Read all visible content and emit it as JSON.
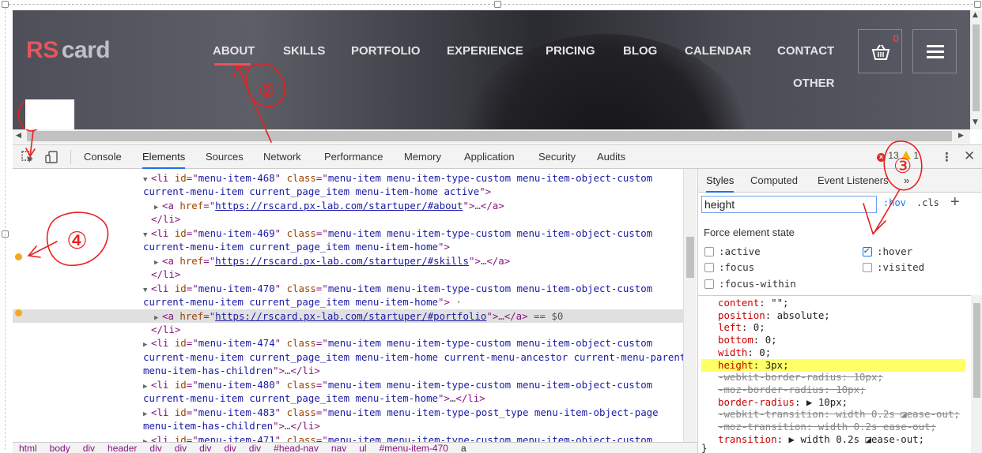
{
  "site": {
    "brand_rs": "RS",
    "brand_card": "card",
    "nav": [
      "ABOUT",
      "SKILLS",
      "PORTFOLIO",
      "EXPERIENCE",
      "PRICING",
      "BLOG",
      "CALENDAR",
      "CONTACT",
      "OTHER"
    ],
    "cart_count": "0",
    "colors": {
      "accent": "#e8545e",
      "nav_text": "#e3e4e8"
    }
  },
  "devtools": {
    "tabs": [
      "Console",
      "Elements",
      "Sources",
      "Network",
      "Performance",
      "Memory",
      "Application",
      "Security",
      "Audits"
    ],
    "active_tab": "Elements",
    "error_count": "13",
    "warning_count": "1",
    "icons": [
      "inspect-element-icon",
      "device-toolbar-icon",
      "error-icon",
      "warning-icon",
      "more-options-icon",
      "close-icon"
    ]
  },
  "elements": {
    "lines": [
      {
        "indent": 1,
        "tw": "▼",
        "parts": [
          [
            "tag",
            "<li "
          ],
          [
            "an",
            "id"
          ],
          [
            "tag",
            "=\""
          ],
          [
            "av",
            "menu-item-468"
          ],
          [
            "tag",
            "\" "
          ],
          [
            "an",
            "class"
          ],
          [
            "tag",
            "=\""
          ],
          [
            "av",
            "menu-item menu-item-type-custom menu-item-object-custom"
          ]
        ]
      },
      {
        "indent": 0,
        "tw": "",
        "parts": [
          [
            "av",
            "current-menu-item current_page_item menu-item-home active"
          ],
          [
            "tag",
            "\">"
          ]
        ]
      },
      {
        "indent": 2,
        "tw": "▶",
        "parts": [
          [
            "tag",
            "<a "
          ],
          [
            "an",
            "href"
          ],
          [
            "tag",
            "=\""
          ],
          [
            "lnk",
            "https://rscard.px-lab.com/startuper/#about"
          ],
          [
            "tag",
            "\">"
          ],
          [
            "dim",
            "…"
          ],
          [
            "tag",
            "</a>"
          ]
        ]
      },
      {
        "indent": 1,
        "tw": " ",
        "parts": [
          [
            "tag",
            "</li>"
          ]
        ]
      },
      {
        "indent": 1,
        "tw": "▼",
        "parts": [
          [
            "tag",
            "<li "
          ],
          [
            "an",
            "id"
          ],
          [
            "tag",
            "=\""
          ],
          [
            "av",
            "menu-item-469"
          ],
          [
            "tag",
            "\" "
          ],
          [
            "an",
            "class"
          ],
          [
            "tag",
            "=\""
          ],
          [
            "av",
            "menu-item menu-item-type-custom menu-item-object-custom"
          ]
        ]
      },
      {
        "indent": 0,
        "tw": "",
        "parts": [
          [
            "av",
            "current-menu-item current_page_item menu-item-home"
          ],
          [
            "tag",
            "\">"
          ]
        ]
      },
      {
        "indent": 2,
        "tw": "▶",
        "parts": [
          [
            "tag",
            "<a "
          ],
          [
            "an",
            "href"
          ],
          [
            "tag",
            "=\""
          ],
          [
            "lnk",
            "https://rscard.px-lab.com/startuper/#skills"
          ],
          [
            "tag",
            "\">"
          ],
          [
            "dim",
            "…"
          ],
          [
            "tag",
            "</a>"
          ]
        ]
      },
      {
        "indent": 1,
        "tw": " ",
        "parts": [
          [
            "tag",
            "</li>"
          ]
        ]
      },
      {
        "indent": 1,
        "tw": "▼",
        "parts": [
          [
            "tag",
            "<li "
          ],
          [
            "an",
            "id"
          ],
          [
            "tag",
            "=\""
          ],
          [
            "av",
            "menu-item-470"
          ],
          [
            "tag",
            "\" "
          ],
          [
            "an",
            "class"
          ],
          [
            "tag",
            "=\""
          ],
          [
            "av",
            "menu-item menu-item-type-custom menu-item-object-custom"
          ]
        ]
      },
      {
        "indent": 0,
        "tw": "",
        "parts": [
          [
            "av",
            "current-menu-item current_page_item menu-item-home"
          ],
          [
            "tag",
            "\">"
          ],
          [
            "dim",
            " ·"
          ]
        ]
      },
      {
        "indent": 2,
        "tw": "▶",
        "hl": true,
        "parts": [
          [
            "tag",
            "<a "
          ],
          [
            "an",
            "href"
          ],
          [
            "tag",
            "=\""
          ],
          [
            "lnk",
            "https://rscard.px-lab.com/startuper/#portfolio"
          ],
          [
            "tag",
            "\">"
          ],
          [
            "dim",
            "…"
          ],
          [
            "tag",
            "</a>"
          ],
          [
            "dim",
            " == $0"
          ]
        ]
      },
      {
        "indent": 1,
        "tw": " ",
        "parts": [
          [
            "tag",
            "</li>"
          ]
        ]
      },
      {
        "indent": 1,
        "tw": "▶",
        "parts": [
          [
            "tag",
            "<li "
          ],
          [
            "an",
            "id"
          ],
          [
            "tag",
            "=\""
          ],
          [
            "av",
            "menu-item-474"
          ],
          [
            "tag",
            "\" "
          ],
          [
            "an",
            "class"
          ],
          [
            "tag",
            "=\""
          ],
          [
            "av",
            "menu-item menu-item-type-custom menu-item-object-custom"
          ]
        ]
      },
      {
        "indent": 0,
        "tw": "",
        "parts": [
          [
            "av",
            "current-menu-item current_page_item menu-item-home current-menu-ancestor current-menu-parent"
          ]
        ]
      },
      {
        "indent": 0,
        "tw": "",
        "parts": [
          [
            "av",
            "menu-item-has-children"
          ],
          [
            "tag",
            "\">"
          ],
          [
            "dim",
            "…"
          ],
          [
            "tag",
            "</li>"
          ]
        ]
      },
      {
        "indent": 1,
        "tw": "▶",
        "parts": [
          [
            "tag",
            "<li "
          ],
          [
            "an",
            "id"
          ],
          [
            "tag",
            "=\""
          ],
          [
            "av",
            "menu-item-480"
          ],
          [
            "tag",
            "\" "
          ],
          [
            "an",
            "class"
          ],
          [
            "tag",
            "=\""
          ],
          [
            "av",
            "menu-item menu-item-type-custom menu-item-object-custom"
          ]
        ]
      },
      {
        "indent": 0,
        "tw": "",
        "parts": [
          [
            "av",
            "current-menu-item current_page_item menu-item-home"
          ],
          [
            "tag",
            "\">"
          ],
          [
            "dim",
            "…"
          ],
          [
            "tag",
            "</li>"
          ]
        ]
      },
      {
        "indent": 1,
        "tw": "▶",
        "parts": [
          [
            "tag",
            "<li "
          ],
          [
            "an",
            "id"
          ],
          [
            "tag",
            "=\""
          ],
          [
            "av",
            "menu-item-483"
          ],
          [
            "tag",
            "\" "
          ],
          [
            "an",
            "class"
          ],
          [
            "tag",
            "=\""
          ],
          [
            "av",
            "menu-item menu-item-type-post_type menu-item-object-page"
          ]
        ]
      },
      {
        "indent": 0,
        "tw": "",
        "parts": [
          [
            "av",
            "menu-item-has-children"
          ],
          [
            "tag",
            "\">"
          ],
          [
            "dim",
            "…"
          ],
          [
            "tag",
            "</li>"
          ]
        ]
      },
      {
        "indent": 1,
        "tw": "▶",
        "parts": [
          [
            "tag",
            "<li "
          ],
          [
            "an",
            "id"
          ],
          [
            "tag",
            "=\""
          ],
          [
            "av",
            "menu-item-471"
          ],
          [
            "tag",
            "\" "
          ],
          [
            "an",
            "class"
          ],
          [
            "tag",
            "=\""
          ],
          [
            "av",
            "menu-item menu-item-type-custom menu-item-object-custom"
          ]
        ]
      }
    ],
    "breadcrumbs": [
      "html",
      "body",
      "div",
      "header",
      "div",
      "div",
      "div",
      "div",
      "div",
      "#head-nav",
      "nav",
      "ul",
      "#menu-item-470",
      "a"
    ]
  },
  "styles": {
    "tabs": [
      "Styles",
      "Computed",
      "Event Listeners",
      "»"
    ],
    "filter_value": "height",
    "hov_label": ":hov",
    "cls_label": ".cls",
    "add_label": "+",
    "force_title": "Force element state",
    "states": [
      {
        "label": ":active",
        "checked": false
      },
      {
        "label": ":hover",
        "checked": true
      },
      {
        "label": ":focus",
        "checked": false
      },
      {
        "label": ":visited",
        "checked": false
      },
      {
        "label": ":focus-within",
        "checked": false
      }
    ],
    "rules": [
      {
        "name": "content",
        "value": "\"\";",
        "strike": false
      },
      {
        "name": "position",
        "value": "absolute;",
        "strike": false
      },
      {
        "name": "left",
        "value": "0;",
        "strike": false
      },
      {
        "name": "bottom",
        "value": "0;",
        "strike": false
      },
      {
        "name": "width",
        "value": "0;",
        "strike": false
      },
      {
        "name": "height",
        "value": "3px;",
        "strike": false,
        "highlight": true
      },
      {
        "name": "-webkit-border-radius",
        "value": "10px;",
        "strike": true
      },
      {
        "name": "-moz-border-radius",
        "value": "10px;",
        "strike": true
      },
      {
        "name": "border-radius",
        "value": "▶ 10px;",
        "strike": false
      },
      {
        "name": "-webkit-transition",
        "value": "width 0.2s ◪ease-out;",
        "strike": true
      },
      {
        "name": "-moz-transition",
        "value": "width 0.2s ease-out;",
        "strike": true
      },
      {
        "name": "transition",
        "value": "▶ width 0.2s ◪ease-out;",
        "strike": false
      }
    ],
    "close_brace": "}"
  },
  "annotations": [
    "①",
    "②",
    "③",
    "④"
  ]
}
